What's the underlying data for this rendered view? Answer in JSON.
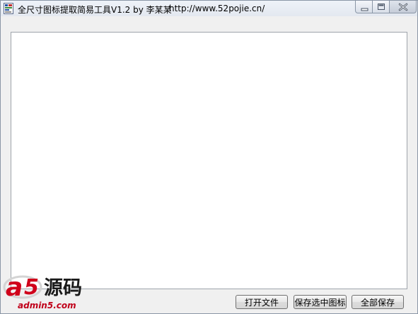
{
  "window": {
    "title": "全尺寸图标提取简易工具V1.2 by 李某某",
    "url": "http://www.52pojie.cn/"
  },
  "buttons": {
    "open_file": "打开文件",
    "save_selected": "保存选中图标",
    "save_all": "全部保存"
  },
  "watermark": {
    "brand_text": "admin5.com",
    "logo_text": "a5源码"
  },
  "icons": {
    "app": "app-icon",
    "minimize": "minimize-icon",
    "maximize": "maximize-icon",
    "close": "close-icon"
  }
}
